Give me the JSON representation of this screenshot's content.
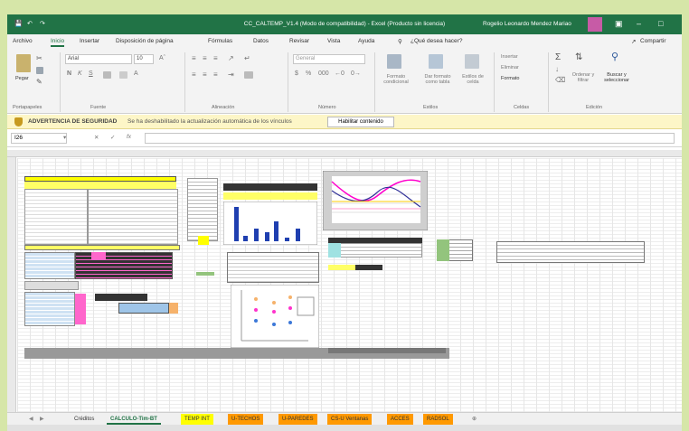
{
  "title_bar": {
    "title": "CC_CALTEMP_V1.4 (Modo de compatibilidad) - Excel (Producto sin licencia)",
    "user": "Rogelio Leonardo Mendez Mariao"
  },
  "menu_tabs": [
    "Archivo",
    "Inicio",
    "Insertar",
    "Disposición de página",
    "Fórmulas",
    "Datos",
    "Revisar",
    "Vista",
    "Ayuda"
  ],
  "tell_me": "¿Qué desea hacer?",
  "share": "Compartir",
  "ribbon": {
    "paste": "Pegar",
    "font_name": "Arial",
    "font_size": "10",
    "number_format": "General",
    "groups": [
      "Portapapeles",
      "Fuente",
      "Alineación",
      "Número",
      "Estilos",
      "Celdas",
      "Edición"
    ],
    "styles_buttons": [
      "Formato condicional",
      "Dar formato como tabla",
      "Estilos de celda"
    ],
    "cells_buttons": [
      "Insertar",
      "Eliminar",
      "Formato"
    ],
    "edit_buttons": [
      "Ordenar y filtrar",
      "Buscar y seleccionar"
    ]
  },
  "security_bar": {
    "heading": "ADVERTENCIA DE SEGURIDAD",
    "message": "Se ha deshabilitado la actualización automática de los vínculos",
    "button": "Habilitar contenido"
  },
  "formula_bar": {
    "name_box": "I26",
    "fx": "fx"
  },
  "sheet_tabs": [
    {
      "label": "Créditos",
      "bg": "#f0f0f0",
      "color": "#333333"
    },
    {
      "label": "CALCULO-Tim-BT",
      "bg": "#ffffff",
      "color": "#217346"
    },
    {
      "label": "TEMP INT",
      "bg": "#ffff00",
      "color": "#333333"
    },
    {
      "label": "U-TECHOS",
      "bg": "#ff9900",
      "color": "#333333"
    },
    {
      "label": "U-PAREDES",
      "bg": "#ff9900",
      "color": "#333333"
    },
    {
      "label": "CS-U Ventanas",
      "bg": "#ff9900",
      "color": "#333333"
    },
    {
      "label": "ACCES",
      "bg": "#ff9900",
      "color": "#333333"
    },
    {
      "label": "RADSOL",
      "bg": "#ff9900",
      "color": "#333333"
    }
  ],
  "colors": {
    "accent": "#217346",
    "pink": "#ff66cc",
    "yellow": "#ffff66",
    "header_yellow": "#ffff00"
  }
}
